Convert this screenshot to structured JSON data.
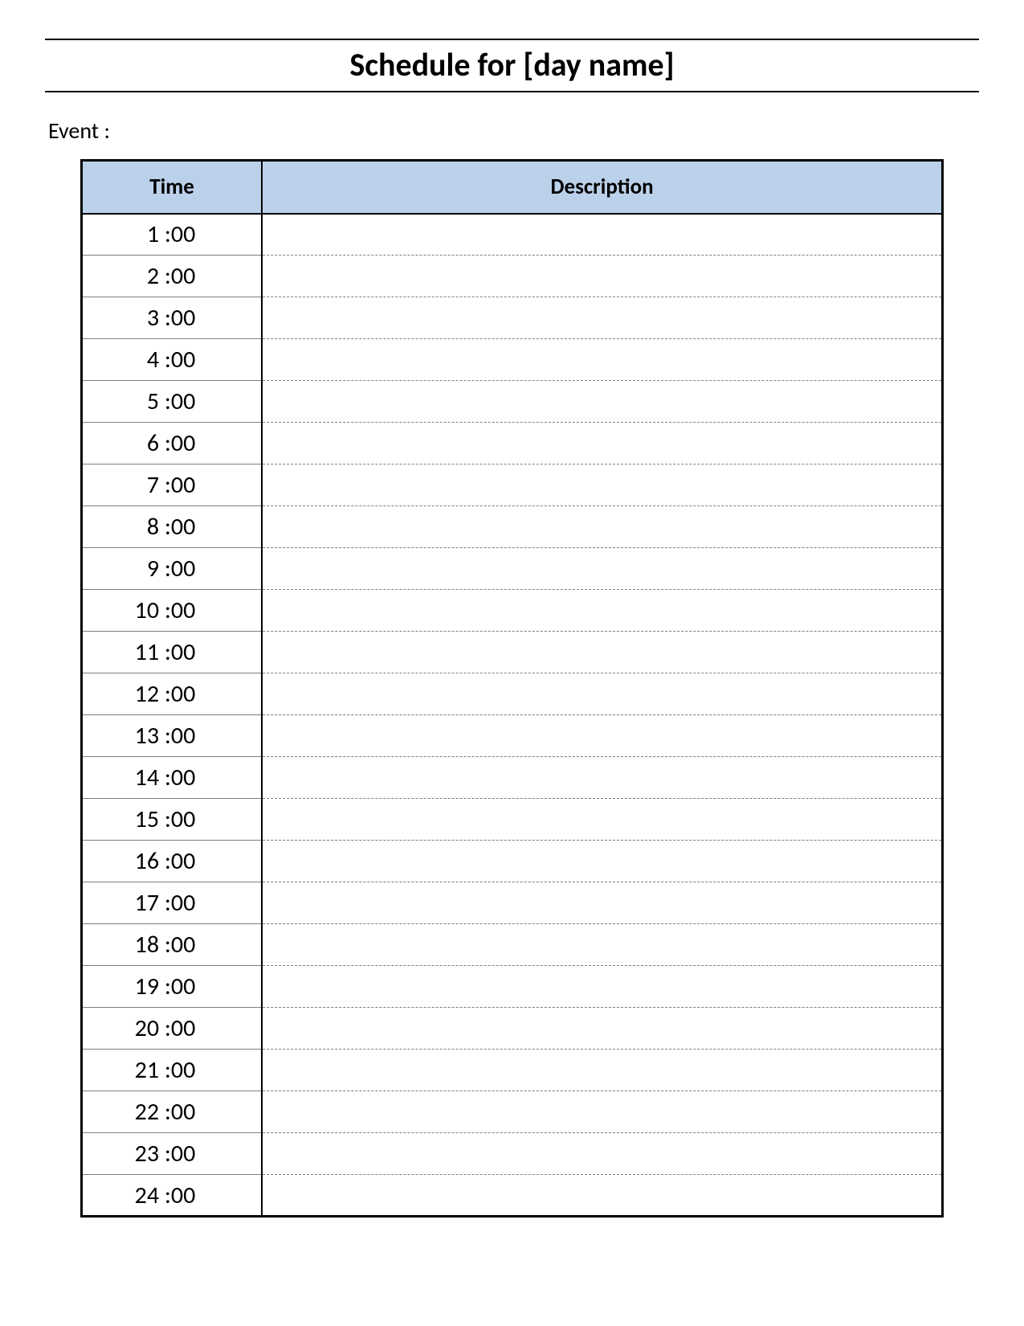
{
  "title": "Schedule for [day name]",
  "event_label": "Event :",
  "columns": {
    "time": "Time",
    "description": "Description"
  },
  "rows": [
    {
      "hour": "1",
      "minutes": ":00",
      "description": ""
    },
    {
      "hour": "2",
      "minutes": ":00",
      "description": ""
    },
    {
      "hour": "3",
      "minutes": ":00",
      "description": ""
    },
    {
      "hour": "4",
      "minutes": ":00",
      "description": ""
    },
    {
      "hour": "5",
      "minutes": ":00",
      "description": ""
    },
    {
      "hour": "6",
      "minutes": ":00",
      "description": ""
    },
    {
      "hour": "7",
      "minutes": ":00",
      "description": ""
    },
    {
      "hour": "8",
      "minutes": ":00",
      "description": ""
    },
    {
      "hour": "9",
      "minutes": ":00",
      "description": ""
    },
    {
      "hour": "10",
      "minutes": ":00",
      "description": ""
    },
    {
      "hour": "11",
      "minutes": ":00",
      "description": ""
    },
    {
      "hour": "12",
      "minutes": ":00",
      "description": ""
    },
    {
      "hour": "13",
      "minutes": ":00",
      "description": ""
    },
    {
      "hour": "14",
      "minutes": ":00",
      "description": ""
    },
    {
      "hour": "15",
      "minutes": ":00",
      "description": ""
    },
    {
      "hour": "16",
      "minutes": ":00",
      "description": ""
    },
    {
      "hour": "17",
      "minutes": ":00",
      "description": ""
    },
    {
      "hour": "18",
      "minutes": ":00",
      "description": ""
    },
    {
      "hour": "19",
      "minutes": ":00",
      "description": ""
    },
    {
      "hour": "20",
      "minutes": ":00",
      "description": ""
    },
    {
      "hour": "21",
      "minutes": ":00",
      "description": ""
    },
    {
      "hour": "22",
      "minutes": ":00",
      "description": ""
    },
    {
      "hour": "23",
      "minutes": ":00",
      "description": ""
    },
    {
      "hour": "24",
      "minutes": ":00",
      "description": ""
    }
  ]
}
